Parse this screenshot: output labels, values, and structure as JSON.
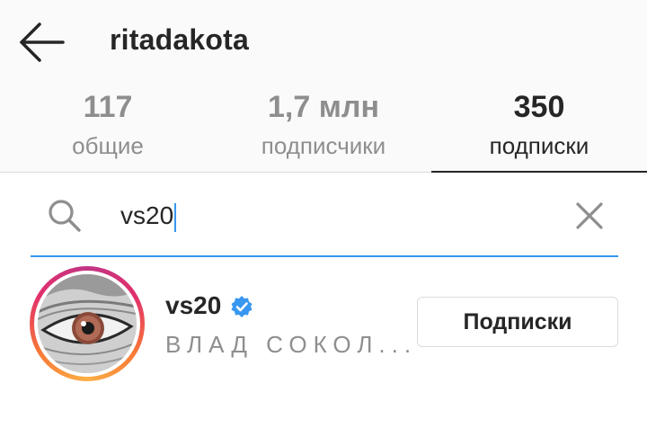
{
  "header": {
    "title": "ritadakota",
    "back_icon": "arrow-left-icon"
  },
  "tabs": [
    {
      "count": "117",
      "label": "общие",
      "active": false
    },
    {
      "count": "1,7 млн",
      "label": "подписчики",
      "active": false
    },
    {
      "count": "350",
      "label": "подписки",
      "active": true
    }
  ],
  "search": {
    "value": "vs20",
    "search_icon": "search-icon",
    "clear_icon": "close-icon",
    "accent": "#3897f0"
  },
  "results": [
    {
      "username": "vs20",
      "verified": true,
      "full_name": "ВЛАД СОКОЛ...",
      "button_label": "Подписки"
    }
  ],
  "colors": {
    "text": "#262626",
    "muted": "#8e8e8e",
    "verified_badge": "#3897f0"
  }
}
